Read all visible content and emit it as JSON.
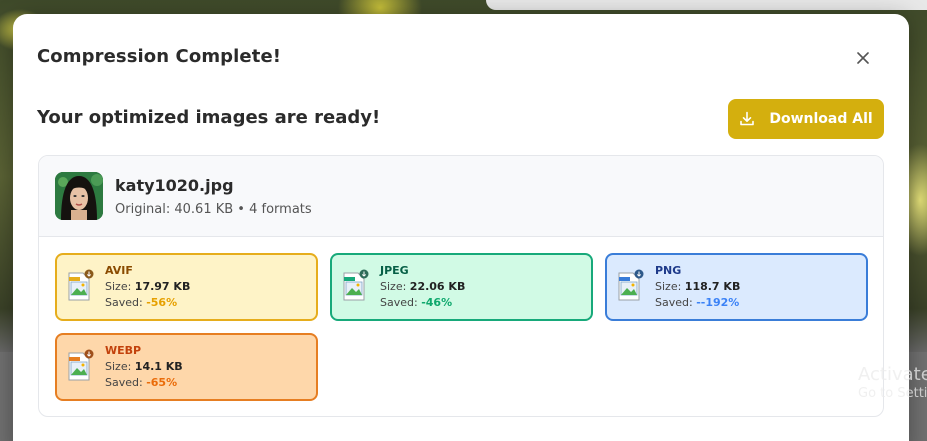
{
  "modal": {
    "title": "Compression Complete!",
    "close_icon": "close-icon",
    "subtitle": "Your optimized images are ready!",
    "download_all_label": "Download All"
  },
  "file": {
    "name": "katy1020.jpg",
    "meta": "Original: 40.61 KB • 4 formats"
  },
  "formats": [
    {
      "name": "AVIF",
      "size_label": "Size:",
      "size": "17.97 KB",
      "saved_label": "Saved:",
      "saved": "-56%",
      "color": "#e6ad1c"
    },
    {
      "name": "JPEG",
      "size_label": "Size:",
      "size": "22.06 KB",
      "saved_label": "Saved:",
      "saved": "-46%",
      "color": "#17a97a"
    },
    {
      "name": "PNG",
      "size_label": "Size:",
      "size": "118.7 KB",
      "saved_label": "Saved:",
      "saved": "--192%",
      "color": "#3a7dd8"
    },
    {
      "name": "WEBP",
      "size_label": "Size:",
      "size": "14.1 KB",
      "saved_label": "Saved:",
      "saved": "-65%",
      "color": "#e67e22"
    }
  ],
  "watermark": {
    "line1": "Activate",
    "line2": "Go to Setti"
  }
}
